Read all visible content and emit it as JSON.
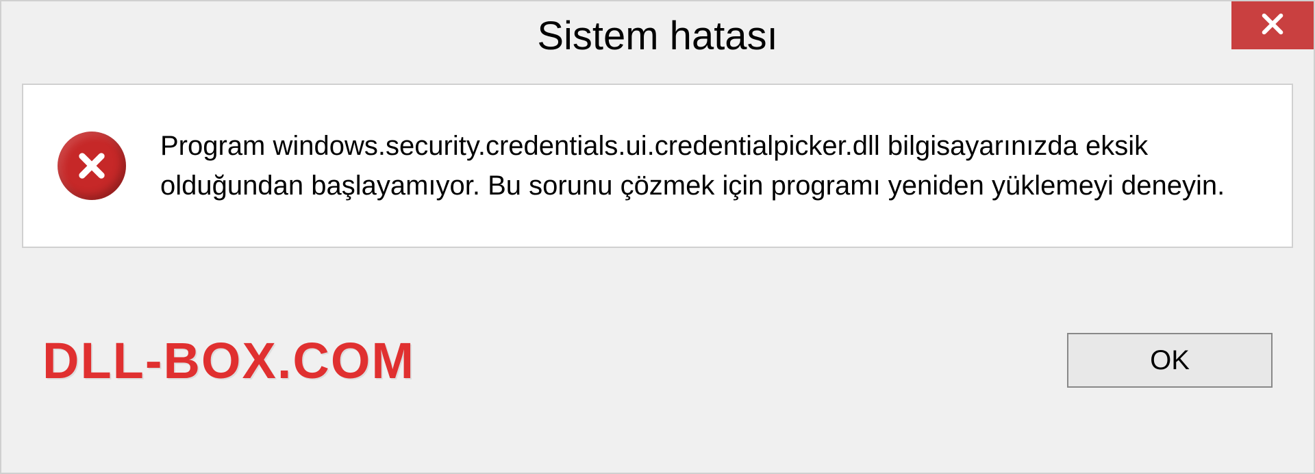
{
  "titlebar": {
    "title": "Sistem hatası"
  },
  "message": {
    "text": "Program windows.security.credentials.ui.credentialpicker.dll bilgisayarınızda eksik olduğundan başlayamıyor. Bu sorunu çözmek için programı yeniden yüklemeyi deneyin."
  },
  "footer": {
    "watermark": "DLL-BOX.COM",
    "ok_label": "OK"
  },
  "icons": {
    "close": "close-icon",
    "error": "error-circle-x-icon"
  },
  "colors": {
    "close_bg": "#c94040",
    "error_bg": "#c62828",
    "watermark": "#e03030",
    "dialog_bg": "#f0f0f0",
    "content_bg": "#ffffff"
  }
}
